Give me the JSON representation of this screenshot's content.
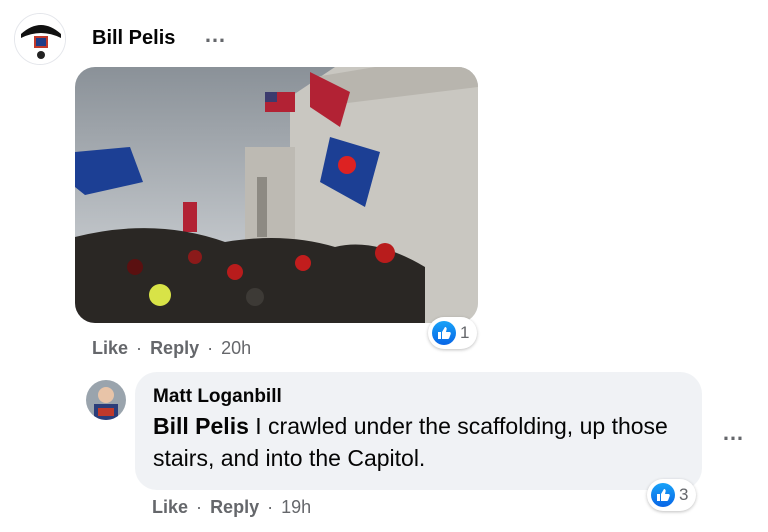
{
  "comment1": {
    "author": "Bill Pelis",
    "more_glyph": "…",
    "reaction_count": "1",
    "like_label": "Like",
    "reply_label": "Reply",
    "separator": "·",
    "time": "20h"
  },
  "comment2": {
    "author": "Matt Loganbill",
    "mention": "Bill Pelis",
    "text": " I crawled under the scaffolding, up those stairs, and into the Capitol.",
    "more_glyph": "…",
    "reaction_count": "3",
    "like_label": "Like",
    "reply_label": "Reply",
    "separator": "·",
    "time": "19h"
  },
  "colors": {
    "like_blue": "#1877f2",
    "meta_grey": "#65676b",
    "bubble_bg": "#f0f2f5"
  },
  "icons": [
    "like-icon",
    "more-options-icon"
  ]
}
